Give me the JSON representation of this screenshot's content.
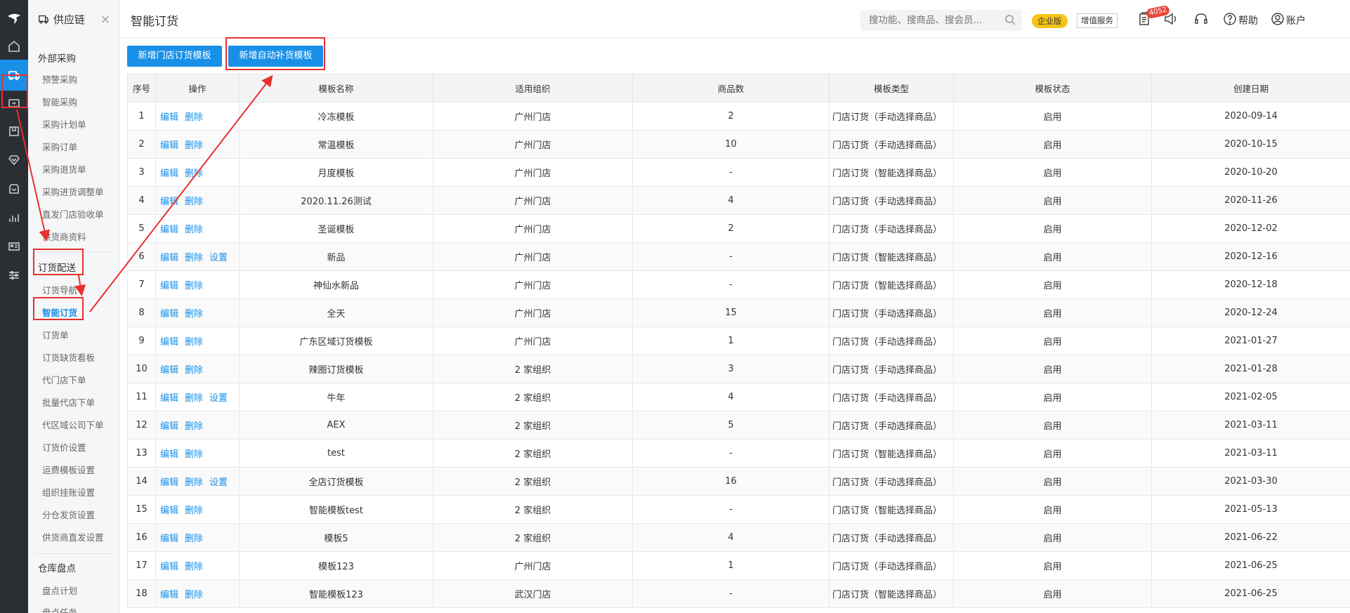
{
  "sidebar": {
    "title": "供应链",
    "close": "×",
    "groups": [
      {
        "title": "外部采购",
        "items": [
          "预警采购",
          "智能采购",
          "采购计划单",
          "采购订单",
          "采购退货单",
          "采购进货调整单",
          "直发门店验收单",
          "供货商资料"
        ]
      },
      {
        "title": "订货配送",
        "items": [
          "订货导航",
          "智能订货",
          "订货单",
          "订货缺货看板",
          "代门店下单",
          "批量代店下单",
          "代区域公司下单",
          "订货价设置",
          "运费模板设置",
          "组织挂账设置",
          "分仓发货设置",
          "供货商直发设置"
        ]
      },
      {
        "title": "仓库盘点",
        "items": [
          "盘点计划",
          "盘点任务"
        ]
      }
    ],
    "active_item": "智能订货"
  },
  "header": {
    "title": "智能订货",
    "search_placeholder": "搜功能、搜商品、搜会员...",
    "edition_badge": "企业版",
    "value_added": "增值服务",
    "message_count": "4052",
    "help": "帮助",
    "account": "账户"
  },
  "actions": {
    "new_store_template": "新增门店订货模板",
    "new_auto_template": "新增自动补货模板"
  },
  "table": {
    "columns": [
      "序号",
      "操作",
      "模板名称",
      "适用组织",
      "商品数",
      "模板类型",
      "模板状态",
      "创建日期"
    ],
    "rows": [
      {
        "no": "1",
        "ops": [
          "编辑",
          "删除"
        ],
        "name": "冷冻模板",
        "org": "广州门店",
        "count": "2",
        "type": "门店订货（手动选择商品）",
        "status": "启用",
        "date": "2020-09-14"
      },
      {
        "no": "2",
        "ops": [
          "编辑",
          "删除"
        ],
        "name": "常温模板",
        "org": "广州门店",
        "count": "10",
        "type": "门店订货（手动选择商品）",
        "status": "启用",
        "date": "2020-10-15"
      },
      {
        "no": "3",
        "ops": [
          "编辑",
          "删除"
        ],
        "name": "月度模板",
        "org": "广州门店",
        "count": "-",
        "type": "门店订货（智能选择商品）",
        "status": "启用",
        "date": "2020-10-20"
      },
      {
        "no": "4",
        "ops": [
          "编辑",
          "删除"
        ],
        "name": "2020.11.26测试",
        "org": "广州门店",
        "count": "4",
        "type": "门店订货（手动选择商品）",
        "status": "启用",
        "date": "2020-11-26"
      },
      {
        "no": "5",
        "ops": [
          "编辑",
          "删除"
        ],
        "name": "圣诞模板",
        "org": "广州门店",
        "count": "2",
        "type": "门店订货（手动选择商品）",
        "status": "启用",
        "date": "2020-12-02"
      },
      {
        "no": "6",
        "ops": [
          "编辑",
          "删除",
          "设置"
        ],
        "name": "新品",
        "org": "广州门店",
        "count": "-",
        "type": "门店订货（智能选择商品）",
        "status": "启用",
        "date": "2020-12-16"
      },
      {
        "no": "7",
        "ops": [
          "编辑",
          "删除"
        ],
        "name": "神仙水新品",
        "org": "广州门店",
        "count": "-",
        "type": "门店订货（智能选择商品）",
        "status": "启用",
        "date": "2020-12-18"
      },
      {
        "no": "8",
        "ops": [
          "编辑",
          "删除"
        ],
        "name": "全天",
        "org": "广州门店",
        "count": "15",
        "type": "门店订货（手动选择商品）",
        "status": "启用",
        "date": "2020-12-24"
      },
      {
        "no": "9",
        "ops": [
          "编辑",
          "删除"
        ],
        "name": "广东区域订货模板",
        "org": "广州门店",
        "count": "1",
        "type": "门店订货（手动选择商品）",
        "status": "启用",
        "date": "2021-01-27"
      },
      {
        "no": "10",
        "ops": [
          "编辑",
          "删除"
        ],
        "name": "辣圈订货模板",
        "org": "2 家组织",
        "count": "3",
        "type": "门店订货（手动选择商品）",
        "status": "启用",
        "date": "2021-01-28"
      },
      {
        "no": "11",
        "ops": [
          "编辑",
          "删除",
          "设置"
        ],
        "name": "牛年",
        "org": "2 家组织",
        "count": "4",
        "type": "门店订货（手动选择商品）",
        "status": "启用",
        "date": "2021-02-05"
      },
      {
        "no": "12",
        "ops": [
          "编辑",
          "删除"
        ],
        "name": "AEX",
        "org": "2 家组织",
        "count": "5",
        "type": "门店订货（手动选择商品）",
        "status": "启用",
        "date": "2021-03-11"
      },
      {
        "no": "13",
        "ops": [
          "编辑",
          "删除"
        ],
        "name": "test",
        "org": "2 家组织",
        "count": "-",
        "type": "门店订货（智能选择商品）",
        "status": "启用",
        "date": "2021-03-11"
      },
      {
        "no": "14",
        "ops": [
          "编辑",
          "删除",
          "设置"
        ],
        "name": "全店订货模板",
        "org": "2 家组织",
        "count": "16",
        "type": "门店订货（手动选择商品）",
        "status": "启用",
        "date": "2021-03-30"
      },
      {
        "no": "15",
        "ops": [
          "编辑",
          "删除"
        ],
        "name": "智能模板test",
        "org": "2 家组织",
        "count": "-",
        "type": "门店订货（智能选择商品）",
        "status": "启用",
        "date": "2021-05-13"
      },
      {
        "no": "16",
        "ops": [
          "编辑",
          "删除"
        ],
        "name": "模板5",
        "org": "2 家组织",
        "count": "4",
        "type": "门店订货（手动选择商品）",
        "status": "启用",
        "date": "2021-06-22"
      },
      {
        "no": "17",
        "ops": [
          "编辑",
          "删除"
        ],
        "name": "模板123",
        "org": "广州门店",
        "count": "1",
        "type": "门店订货（手动选择商品）",
        "status": "启用",
        "date": "2021-06-25"
      },
      {
        "no": "18",
        "ops": [
          "编辑",
          "删除"
        ],
        "name": "智能模板123",
        "org": "武汉门店",
        "count": "-",
        "type": "门店订货（智能选择商品）",
        "status": "启用",
        "date": "2021-06-25"
      }
    ]
  },
  "icons": {
    "rail": [
      "home-icon",
      "supply-chain-icon",
      "wallet-icon",
      "box-icon",
      "diamond-icon",
      "store-icon",
      "chart-icon",
      "id-card-icon",
      "sliders-icon"
    ],
    "topbar": [
      "search-icon",
      "clipboard-icon",
      "broadcast-icon",
      "headset-icon",
      "help-icon",
      "user-icon"
    ]
  },
  "colors": {
    "primary": "#1890e8",
    "rail_bg": "#2b2f33",
    "highlight_red": "#e8302f",
    "edition_yellow": "#f6c515",
    "badge_red": "#e8453c"
  }
}
